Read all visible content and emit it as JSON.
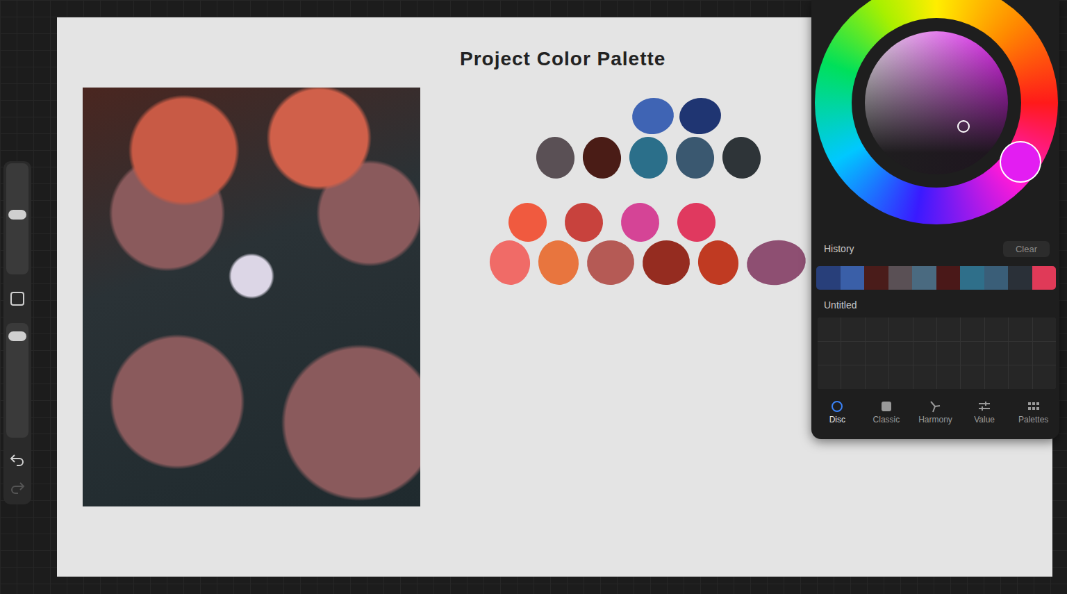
{
  "canvas": {
    "title": "Project Color Palette",
    "swatch_rows": [
      {
        "swatches": [
          {
            "color": "#3f64b4"
          },
          {
            "color": "#1f3572"
          }
        ]
      },
      {
        "swatches": [
          {
            "color": "#5a5055"
          },
          {
            "color": "#4a1c16"
          },
          {
            "color": "#2b6f8a"
          },
          {
            "color": "#3a5870"
          },
          {
            "color": "#2e3438"
          }
        ]
      },
      {
        "swatches": [
          {
            "color": "#f05a3f"
          },
          {
            "color": "#c8423d"
          },
          {
            "color": "#d54496"
          },
          {
            "color": "#e0395f"
          }
        ]
      },
      {
        "swatches": [
          {
            "color": "#f06b67"
          },
          {
            "color": "#e8753e"
          },
          {
            "color": "#b55a55"
          },
          {
            "color": "#952c20"
          },
          {
            "color": "#c03a22"
          },
          {
            "color": "#8e4f72"
          },
          {
            "color": "#9a3a2e"
          }
        ]
      }
    ]
  },
  "sidebar": {
    "sliders": [
      {
        "level": 0.54
      },
      {
        "level": 0.92
      }
    ],
    "undo_enabled": true,
    "redo_enabled": false
  },
  "color_panel": {
    "current_color": "#e31df2",
    "history_label": "History",
    "clear_button": "Clear",
    "history": [
      {
        "color": "#283f7a"
      },
      {
        "color": "#3a5fa8"
      },
      {
        "color": "#4a1c1a"
      },
      {
        "color": "#5a5055"
      },
      {
        "color": "#4a6a80"
      },
      {
        "color": "#4a1818"
      },
      {
        "color": "#2f6f8a"
      },
      {
        "color": "#3a5e78"
      },
      {
        "color": "#2a3038"
      },
      {
        "color": "#e03a58"
      }
    ],
    "palette_name": "Untitled",
    "tabs": [
      {
        "label": "Disc",
        "selected": true
      },
      {
        "label": "Classic",
        "selected": false
      },
      {
        "label": "Harmony",
        "selected": false
      },
      {
        "label": "Value",
        "selected": false
      },
      {
        "label": "Palettes",
        "selected": false
      }
    ]
  }
}
